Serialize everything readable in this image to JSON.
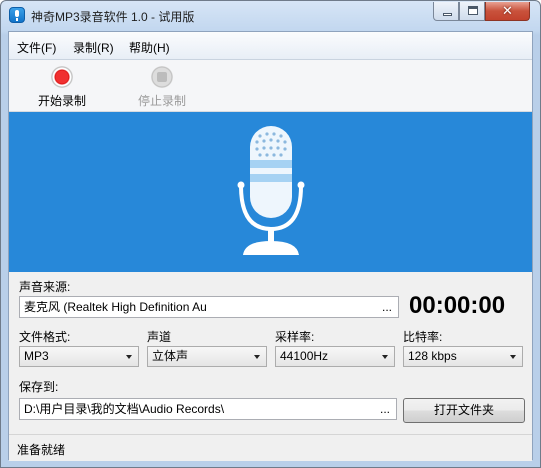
{
  "window": {
    "title": "神奇MP3录音软件 1.0 - 试用版",
    "close_glyph": "✕"
  },
  "menu": {
    "items": [
      "文件(F)",
      "录制(R)",
      "帮助(H)"
    ]
  },
  "toolbar": {
    "start_label": "开始录制",
    "stop_label": "停止录制"
  },
  "source": {
    "label": "声音来源:",
    "value": "麦克风 (Realtek High Definition Au",
    "browse": "..."
  },
  "timer": "00:00:00",
  "format": {
    "label": "文件格式:",
    "value": "MP3"
  },
  "channel": {
    "label": "声道",
    "value": "立体声"
  },
  "samplerate": {
    "label": "采样率:",
    "value": "44100Hz"
  },
  "bitrate": {
    "label": "比特率:",
    "value": "128 kbps"
  },
  "save": {
    "label": "保存到:",
    "path": "D:\\用户目录\\我的文档\\Audio Records\\",
    "browse": "...",
    "open_folder": "打开文件夹"
  },
  "status": "准备就绪",
  "colors": {
    "banner": "#2788d9",
    "record": "#e81f1f"
  }
}
